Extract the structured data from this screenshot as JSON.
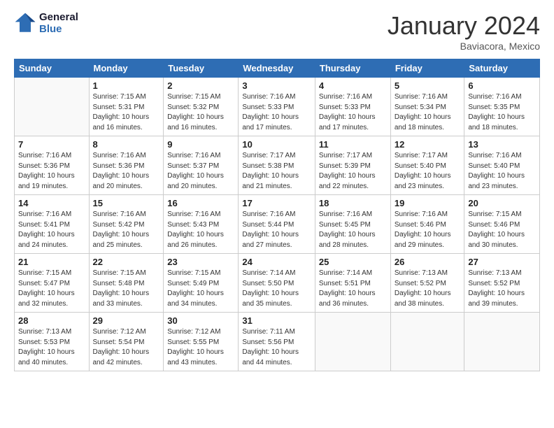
{
  "logo": {
    "line1": "General",
    "line2": "Blue"
  },
  "title": "January 2024",
  "location": "Baviacora, Mexico",
  "weekdays": [
    "Sunday",
    "Monday",
    "Tuesday",
    "Wednesday",
    "Thursday",
    "Friday",
    "Saturday"
  ],
  "weeks": [
    [
      {
        "day": "",
        "info": ""
      },
      {
        "day": "1",
        "info": "Sunrise: 7:15 AM\nSunset: 5:31 PM\nDaylight: 10 hours\nand 16 minutes."
      },
      {
        "day": "2",
        "info": "Sunrise: 7:15 AM\nSunset: 5:32 PM\nDaylight: 10 hours\nand 16 minutes."
      },
      {
        "day": "3",
        "info": "Sunrise: 7:16 AM\nSunset: 5:33 PM\nDaylight: 10 hours\nand 17 minutes."
      },
      {
        "day": "4",
        "info": "Sunrise: 7:16 AM\nSunset: 5:33 PM\nDaylight: 10 hours\nand 17 minutes."
      },
      {
        "day": "5",
        "info": "Sunrise: 7:16 AM\nSunset: 5:34 PM\nDaylight: 10 hours\nand 18 minutes."
      },
      {
        "day": "6",
        "info": "Sunrise: 7:16 AM\nSunset: 5:35 PM\nDaylight: 10 hours\nand 18 minutes."
      }
    ],
    [
      {
        "day": "7",
        "info": "Sunrise: 7:16 AM\nSunset: 5:36 PM\nDaylight: 10 hours\nand 19 minutes."
      },
      {
        "day": "8",
        "info": "Sunrise: 7:16 AM\nSunset: 5:36 PM\nDaylight: 10 hours\nand 20 minutes."
      },
      {
        "day": "9",
        "info": "Sunrise: 7:16 AM\nSunset: 5:37 PM\nDaylight: 10 hours\nand 20 minutes."
      },
      {
        "day": "10",
        "info": "Sunrise: 7:17 AM\nSunset: 5:38 PM\nDaylight: 10 hours\nand 21 minutes."
      },
      {
        "day": "11",
        "info": "Sunrise: 7:17 AM\nSunset: 5:39 PM\nDaylight: 10 hours\nand 22 minutes."
      },
      {
        "day": "12",
        "info": "Sunrise: 7:17 AM\nSunset: 5:40 PM\nDaylight: 10 hours\nand 23 minutes."
      },
      {
        "day": "13",
        "info": "Sunrise: 7:16 AM\nSunset: 5:40 PM\nDaylight: 10 hours\nand 23 minutes."
      }
    ],
    [
      {
        "day": "14",
        "info": "Sunrise: 7:16 AM\nSunset: 5:41 PM\nDaylight: 10 hours\nand 24 minutes."
      },
      {
        "day": "15",
        "info": "Sunrise: 7:16 AM\nSunset: 5:42 PM\nDaylight: 10 hours\nand 25 minutes."
      },
      {
        "day": "16",
        "info": "Sunrise: 7:16 AM\nSunset: 5:43 PM\nDaylight: 10 hours\nand 26 minutes."
      },
      {
        "day": "17",
        "info": "Sunrise: 7:16 AM\nSunset: 5:44 PM\nDaylight: 10 hours\nand 27 minutes."
      },
      {
        "day": "18",
        "info": "Sunrise: 7:16 AM\nSunset: 5:45 PM\nDaylight: 10 hours\nand 28 minutes."
      },
      {
        "day": "19",
        "info": "Sunrise: 7:16 AM\nSunset: 5:46 PM\nDaylight: 10 hours\nand 29 minutes."
      },
      {
        "day": "20",
        "info": "Sunrise: 7:15 AM\nSunset: 5:46 PM\nDaylight: 10 hours\nand 30 minutes."
      }
    ],
    [
      {
        "day": "21",
        "info": "Sunrise: 7:15 AM\nSunset: 5:47 PM\nDaylight: 10 hours\nand 32 minutes."
      },
      {
        "day": "22",
        "info": "Sunrise: 7:15 AM\nSunset: 5:48 PM\nDaylight: 10 hours\nand 33 minutes."
      },
      {
        "day": "23",
        "info": "Sunrise: 7:15 AM\nSunset: 5:49 PM\nDaylight: 10 hours\nand 34 minutes."
      },
      {
        "day": "24",
        "info": "Sunrise: 7:14 AM\nSunset: 5:50 PM\nDaylight: 10 hours\nand 35 minutes."
      },
      {
        "day": "25",
        "info": "Sunrise: 7:14 AM\nSunset: 5:51 PM\nDaylight: 10 hours\nand 36 minutes."
      },
      {
        "day": "26",
        "info": "Sunrise: 7:13 AM\nSunset: 5:52 PM\nDaylight: 10 hours\nand 38 minutes."
      },
      {
        "day": "27",
        "info": "Sunrise: 7:13 AM\nSunset: 5:52 PM\nDaylight: 10 hours\nand 39 minutes."
      }
    ],
    [
      {
        "day": "28",
        "info": "Sunrise: 7:13 AM\nSunset: 5:53 PM\nDaylight: 10 hours\nand 40 minutes."
      },
      {
        "day": "29",
        "info": "Sunrise: 7:12 AM\nSunset: 5:54 PM\nDaylight: 10 hours\nand 42 minutes."
      },
      {
        "day": "30",
        "info": "Sunrise: 7:12 AM\nSunset: 5:55 PM\nDaylight: 10 hours\nand 43 minutes."
      },
      {
        "day": "31",
        "info": "Sunrise: 7:11 AM\nSunset: 5:56 PM\nDaylight: 10 hours\nand 44 minutes."
      },
      {
        "day": "",
        "info": ""
      },
      {
        "day": "",
        "info": ""
      },
      {
        "day": "",
        "info": ""
      }
    ]
  ]
}
